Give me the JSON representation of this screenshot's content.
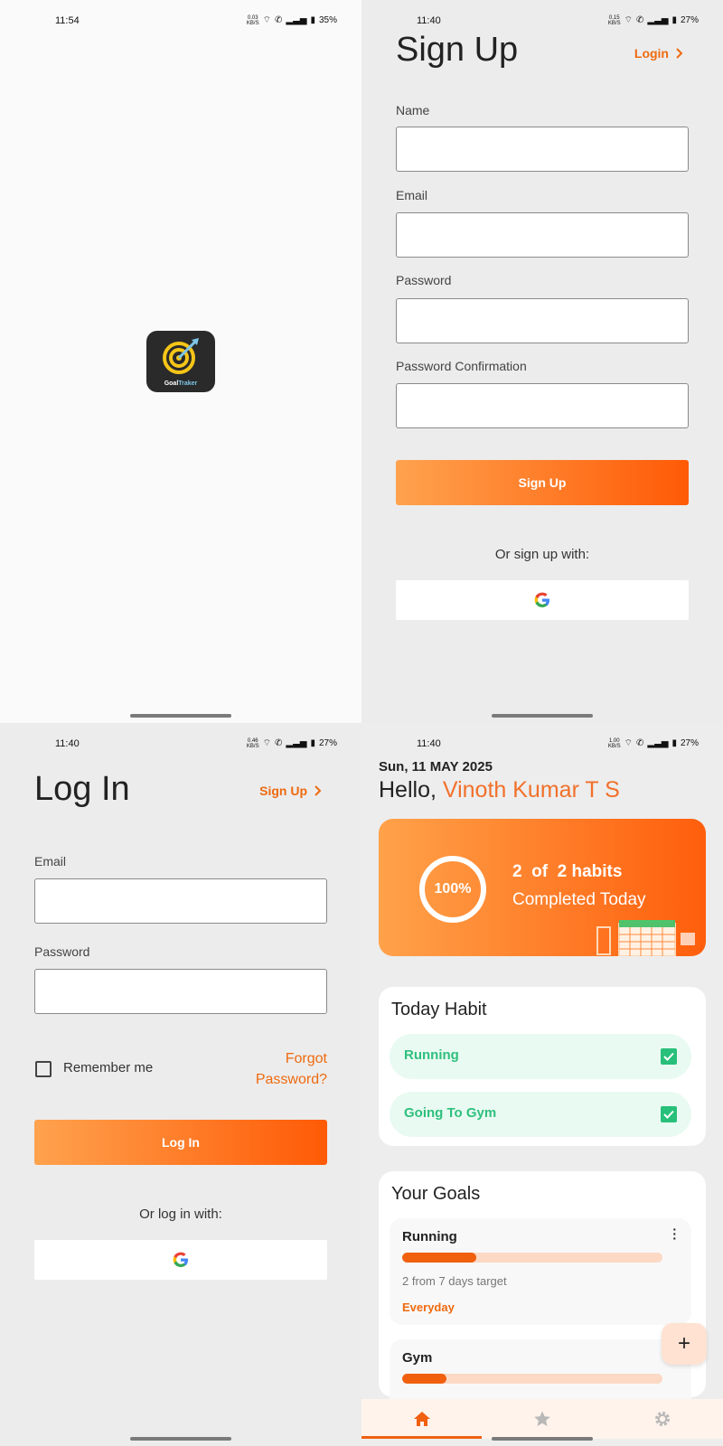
{
  "colors": {
    "accent": "#f0600e",
    "accent_light": "#ffa24e",
    "habit_bg": "#e8faf1",
    "habit_text": "#2fbf7e",
    "progress_track": "#fcd9c4"
  },
  "splash": {
    "status": {
      "time": "11:54",
      "net_speed": "0.03",
      "net_unit": "KB/S",
      "battery": "35%"
    },
    "app_icon": {
      "icon": "target-arrow-icon",
      "brand_first": "Goal",
      "brand_second": "Traker"
    }
  },
  "signup": {
    "status": {
      "time": "11:40",
      "net_speed": "0.15",
      "net_unit": "KB/S",
      "battery": "27%"
    },
    "title": "Sign Up",
    "login_link": "Login",
    "fields": {
      "name_label": "Name",
      "email_label": "Email",
      "password_label": "Password",
      "password_confirm_label": "Password Confirmation"
    },
    "submit_label": "Sign Up",
    "alt_text": "Or sign up with:"
  },
  "login": {
    "status": {
      "time": "11:40",
      "net_speed": "0.46",
      "net_unit": "KB/S",
      "battery": "27%"
    },
    "title": "Log In",
    "signup_link": "Sign Up",
    "email_label": "Email",
    "password_label": "Password",
    "remember_label": "Remember me",
    "forgot_line1": "Forgot",
    "forgot_line2": "Password?",
    "submit_label": "Log In",
    "alt_text": "Or log in  with:"
  },
  "dashboard": {
    "status": {
      "time": "11:40",
      "net_speed": "1.00",
      "net_unit": "KB/S",
      "battery": "27%"
    },
    "date": "Sun, 11 MAY 2025",
    "greeting": "Hello, ",
    "user_name": "Vinoth Kumar T S",
    "summary": {
      "percent": "100%",
      "percent_value": 1.0,
      "line1": "2  of  2 habits",
      "line2": "Completed Today"
    },
    "today_habit_title": "Today Habit",
    "habits": [
      {
        "label": "Running",
        "checked": true
      },
      {
        "label": "Going To Gym",
        "checked": true
      }
    ],
    "goals_title": "Your Goals",
    "goals": [
      {
        "name": "Running",
        "progress": 0.2857,
        "target": "2 from 7 days target",
        "frequency": "Everyday"
      },
      {
        "name": "Gym",
        "progress": 0.17
      }
    ],
    "fab_label": "+",
    "nav": [
      {
        "icon": "home-icon",
        "active": true
      },
      {
        "icon": "star-icon",
        "active": false
      },
      {
        "icon": "gear-icon",
        "active": false
      }
    ]
  }
}
